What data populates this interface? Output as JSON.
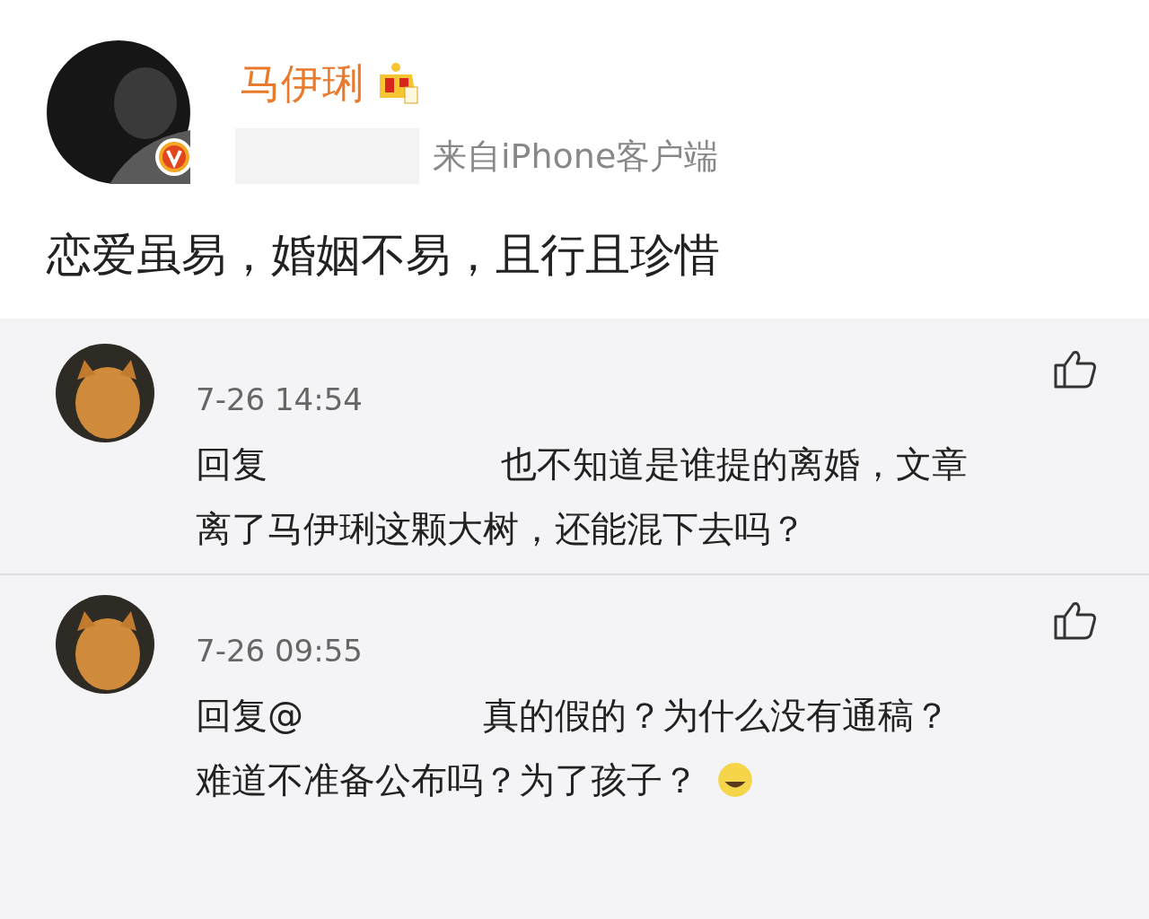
{
  "post": {
    "author": "马伊琍",
    "source": "来自iPhone客户端",
    "text": "恋爱虽易，婚姻不易，且行且珍惜"
  },
  "comments": [
    {
      "time": "7-26 14:54",
      "reply_prefix": "回复",
      "lines": [
        "也不知道是谁提的离婚，文章",
        "离了马伊琍这颗大树，还能混下去吗？"
      ],
      "emoji": false
    },
    {
      "time": "7-26 09:55",
      "reply_prefix": "回复@",
      "lines": [
        "真的假的？为什么没有通稿？",
        "难道不准备公布吗？为了孩子？"
      ],
      "emoji": true
    }
  ]
}
